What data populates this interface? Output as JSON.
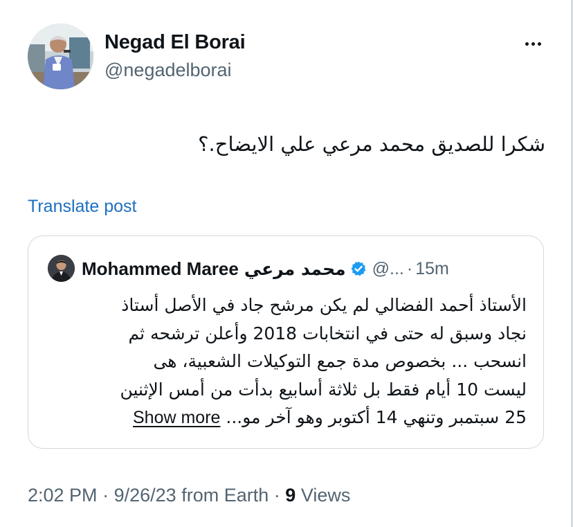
{
  "author": {
    "name": "Negad El Borai",
    "handle": "@negadelborai"
  },
  "icons": {
    "more": "more-horizontal-icon",
    "verified": "verified-badge-icon"
  },
  "tweet": {
    "text": "شكرا للصديق محمد مرعي علي الايضاح.؟",
    "translate_label": "Translate post"
  },
  "quote": {
    "author_name": "Mohammed Maree",
    "author_name_ar": "محمد مرعي",
    "handle": "@...",
    "separator": "·",
    "time": "15m",
    "lines": [
      "الأستاذ أحمد الفضالي لم يكن مرشح جاد في الأصل أستاذ",
      "نجاد وسبق له حتى في انتخابات 2018 وأعلن ترشحه ثم",
      "انسحب ... بخصوص مدة جمع التوكيلات الشعبية، هى",
      "ليست 10 أيام فقط بل ثلاثة أسابيع بدأت من أمس الإثنين",
      "25 سبتمبر وتنهي 14 أكتوبر وهو آخر مو..."
    ],
    "show_more_label": "Show more"
  },
  "meta": {
    "time": "2:02 PM",
    "date": "9/26/23",
    "source": "from Earth",
    "separator": "·",
    "views_count": "9",
    "views_label": "Views"
  },
  "colors": {
    "text": "#0f1419",
    "secondary": "#536471",
    "link": "#1d6fbf",
    "border": "#cfd9de",
    "verified": "#1d9bf0"
  }
}
